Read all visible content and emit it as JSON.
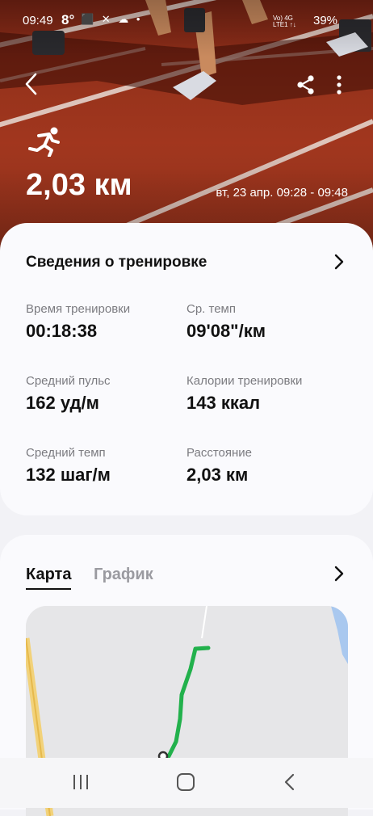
{
  "status_bar": {
    "time": "09:49",
    "temperature": "8°",
    "notification_icons": "⬛ ✕ ☁ •",
    "network_line1": "Vo) 4G",
    "network_line2": "LTE1 ↑↓",
    "battery": "39%"
  },
  "header": {
    "back_icon": "back-arrow-icon",
    "share_icon": "share-icon",
    "more_icon": "more-vertical-icon",
    "activity_icon": "running-icon",
    "distance": "2,03 км",
    "datetime": "вт, 23 апр. 09:28 - 09:48"
  },
  "workout_details": {
    "title": "Сведения о тренировке",
    "stats": [
      {
        "label": "Время тренировки",
        "value": "00:18:38"
      },
      {
        "label": "Ср. темп",
        "value": "09'08\"/км"
      },
      {
        "label": "Средний пульс",
        "value": "162 уд/м"
      },
      {
        "label": "Калории тренировки",
        "value": "143 ккал"
      },
      {
        "label": "Средний темп",
        "value": "132 шаг/м"
      },
      {
        "label": "Расстояние",
        "value": "2,03 км"
      }
    ]
  },
  "map_section": {
    "tabs": [
      {
        "label": "Карта",
        "active": true
      },
      {
        "label": "График",
        "active": false
      }
    ],
    "route_color": "#22b14c"
  },
  "nav_bar": {
    "recents_icon": "recents-icon",
    "home_icon": "home-icon",
    "back_icon": "nav-back-icon"
  }
}
